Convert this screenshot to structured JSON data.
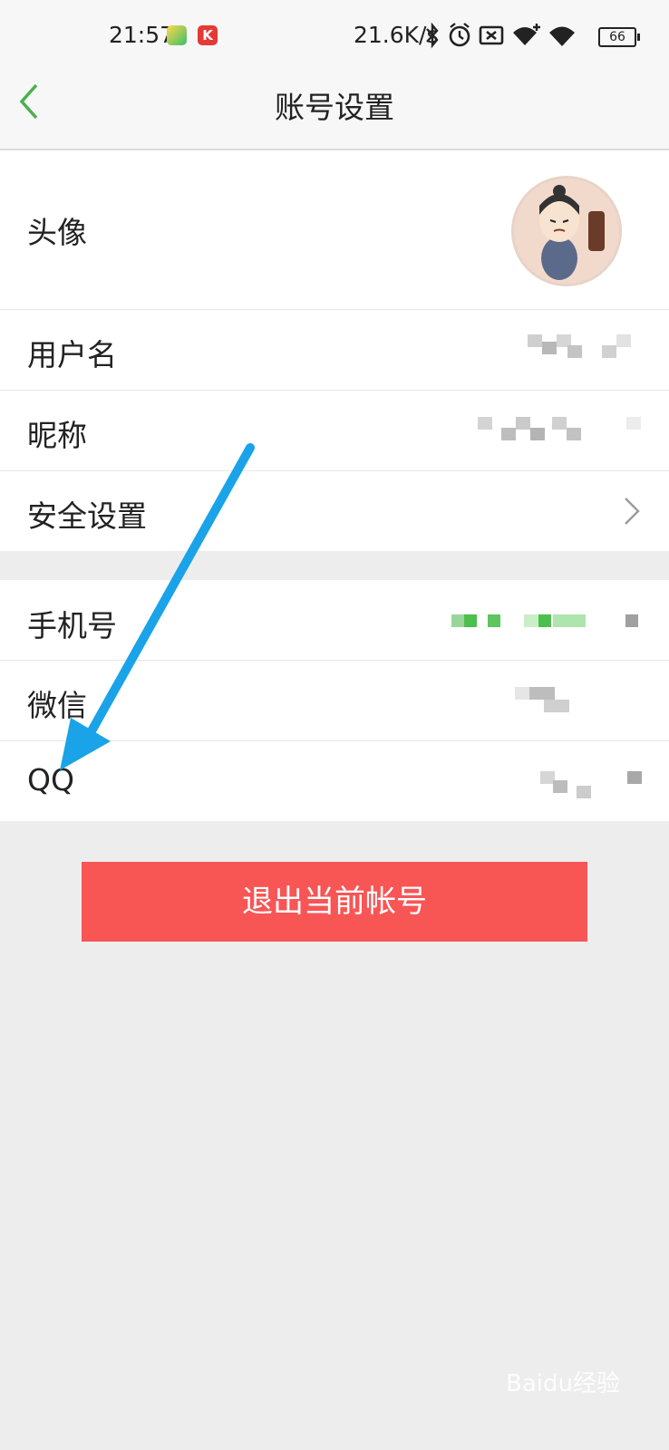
{
  "status_bar": {
    "time": "21:57",
    "network_speed": "21.6K/s",
    "battery": "66",
    "icons": [
      "app-icon",
      "kugou-icon",
      "bluetooth-icon",
      "alarm-icon",
      "sim-icon",
      "wifi-plus-icon",
      "wifi-icon",
      "battery-icon"
    ]
  },
  "nav": {
    "title": "账号设置",
    "back_icon": "chevron-left-icon",
    "accent_color": "#4caf50"
  },
  "profile_rows": [
    {
      "label": "头像",
      "value": "avatar-image"
    },
    {
      "label": "用户名"
    },
    {
      "label": "昵称"
    },
    {
      "label": "安全设置",
      "icon": "chevron-right-icon"
    }
  ],
  "account_rows": [
    {
      "label": "手机号"
    },
    {
      "label": "微信"
    },
    {
      "label": "QQ"
    }
  ],
  "logout_button": {
    "label": "退出当前帐号",
    "color": "#f85555"
  },
  "annotation": {
    "arrow_color": "#1aa3e8"
  },
  "watermark": "Baidu经验"
}
